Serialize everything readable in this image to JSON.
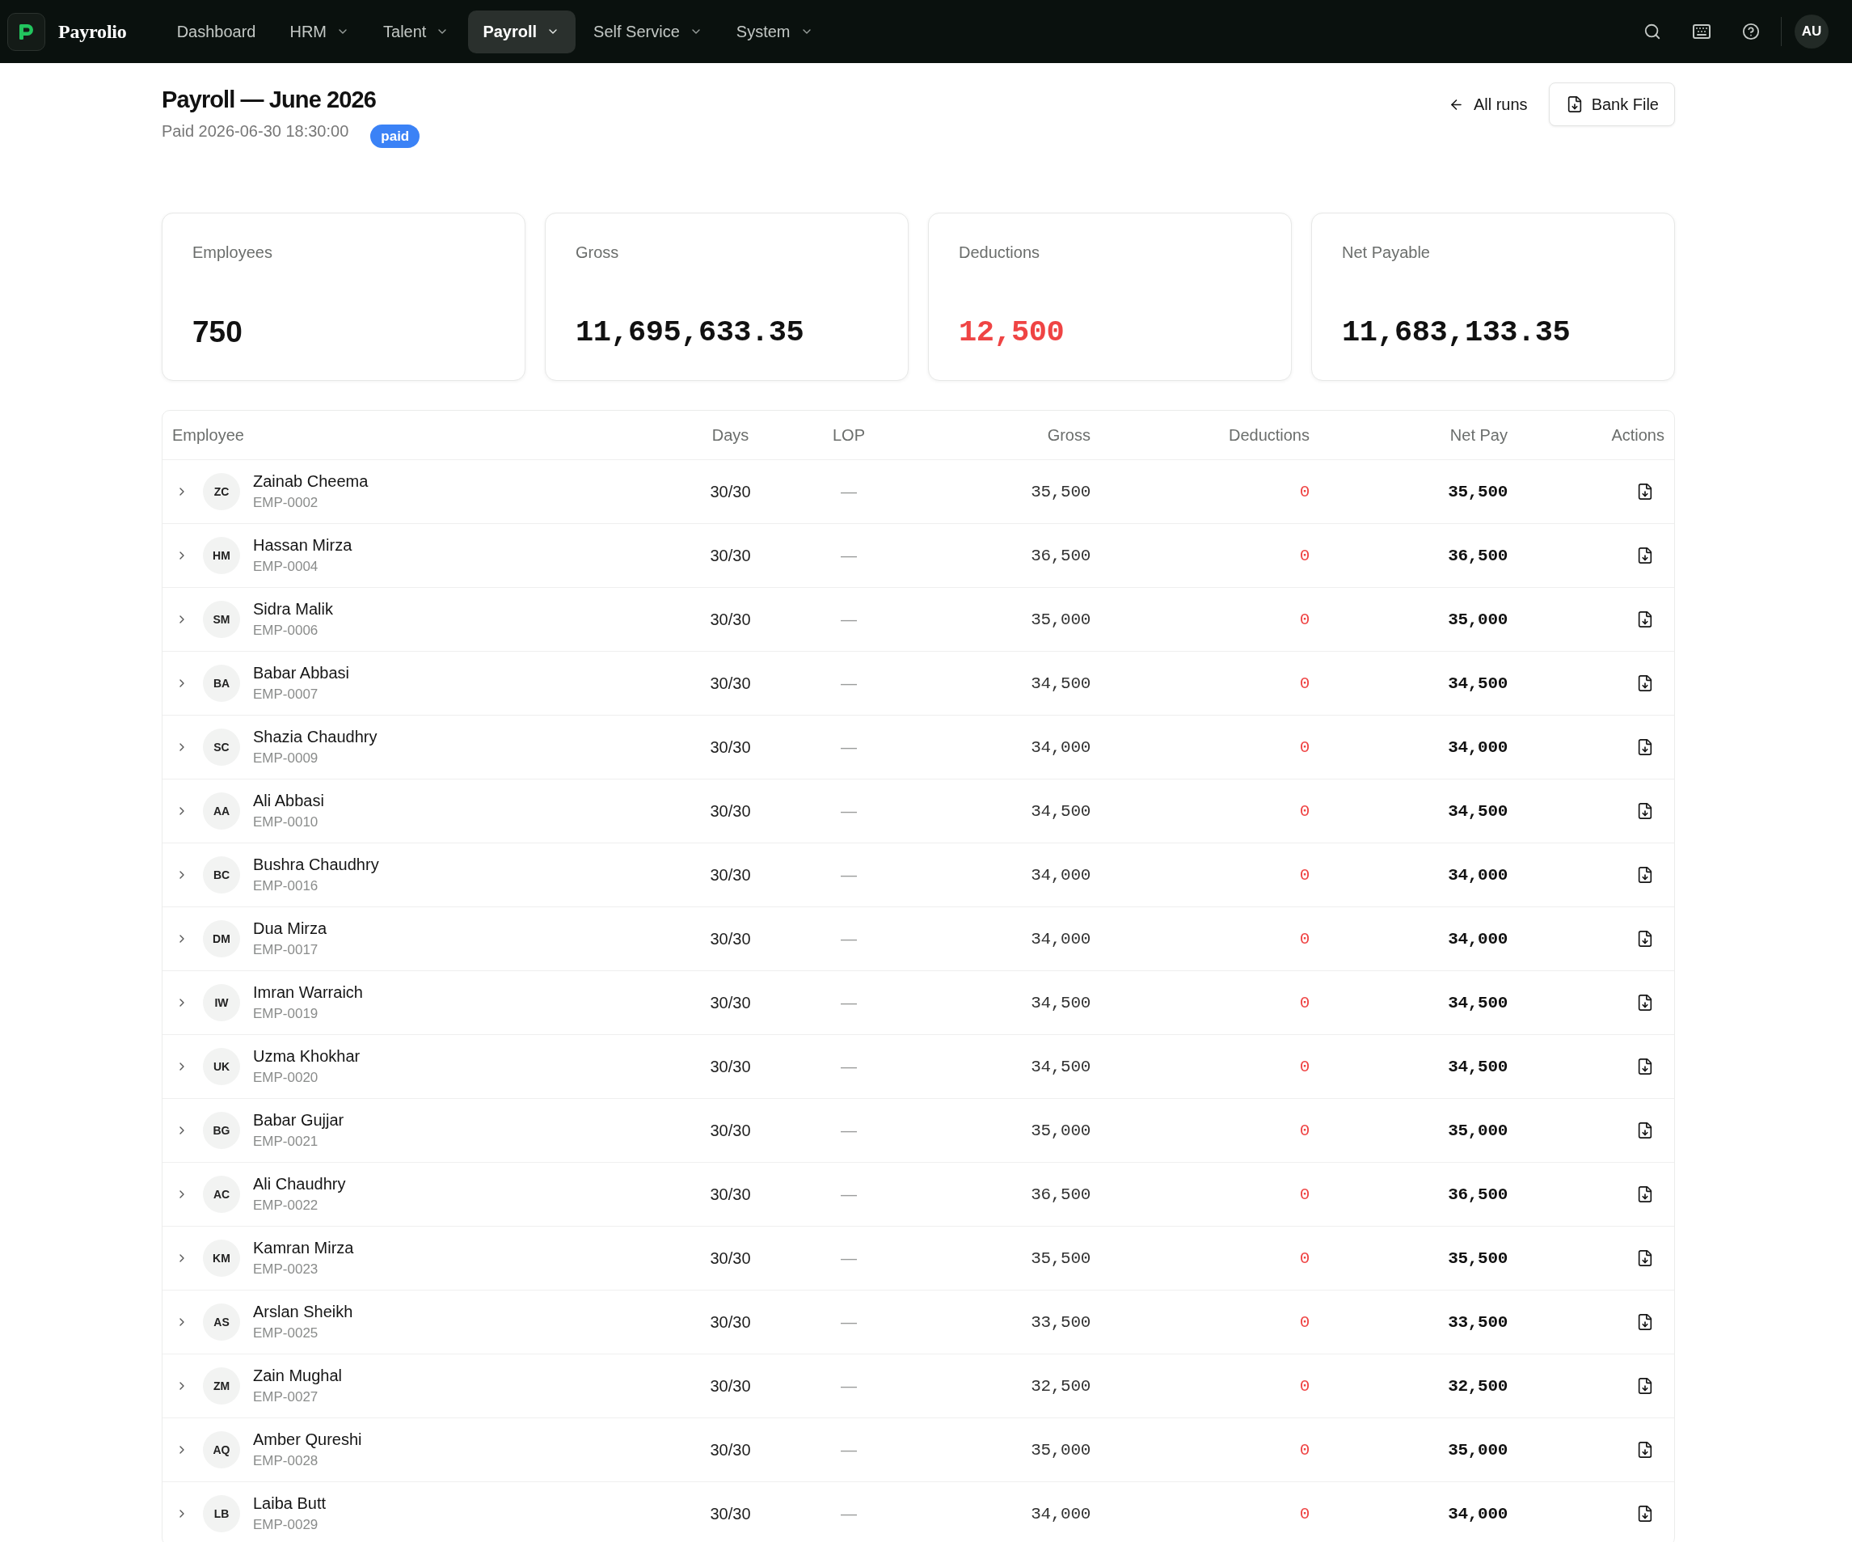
{
  "app": {
    "brand": "Payrolio"
  },
  "nav": {
    "items": [
      {
        "label": "Dashboard",
        "has_menu": false,
        "selected": false
      },
      {
        "label": "HRM",
        "has_menu": true,
        "selected": false
      },
      {
        "label": "Talent",
        "has_menu": true,
        "selected": false
      },
      {
        "label": "Payroll",
        "has_menu": true,
        "selected": true
      },
      {
        "label": "Self Service",
        "has_menu": true,
        "selected": false
      },
      {
        "label": "System",
        "has_menu": true,
        "selected": false
      }
    ]
  },
  "user": {
    "initials": "AU"
  },
  "header": {
    "title": "Payroll — June 2026",
    "subtitle": "Paid 2026-06-30 18:30:00",
    "badge": "paid",
    "back_link": "All runs",
    "button": "Bank File"
  },
  "stats": [
    {
      "label": "Employees",
      "value": "750",
      "kind": "count"
    },
    {
      "label": "Gross",
      "value": "11,695,633.35",
      "kind": "amount"
    },
    {
      "label": "Deductions",
      "value": "12,500",
      "kind": "deduction"
    },
    {
      "label": "Net Payable",
      "value": "11,683,133.35",
      "kind": "amount"
    }
  ],
  "table": {
    "columns": [
      "Employee",
      "Days",
      "LOP",
      "Gross",
      "Deductions",
      "Net Pay",
      "Actions"
    ],
    "rows": [
      {
        "initials": "ZC",
        "name": "Zainab Cheema",
        "id": "EMP-0002",
        "days": "30/30",
        "lop": "—",
        "gross": "35,500",
        "deductions": "0",
        "net_pay": "35,500",
        "expanded": false
      },
      {
        "initials": "HM",
        "name": "Hassan Mirza",
        "id": "EMP-0004",
        "days": "30/30",
        "lop": "—",
        "gross": "36,500",
        "deductions": "0",
        "net_pay": "36,500",
        "expanded": false
      },
      {
        "initials": "SM",
        "name": "Sidra Malik",
        "id": "EMP-0006",
        "days": "30/30",
        "lop": "—",
        "gross": "35,000",
        "deductions": "0",
        "net_pay": "35,000",
        "expanded": false
      },
      {
        "initials": "BA",
        "name": "Babar Abbasi",
        "id": "EMP-0007",
        "days": "30/30",
        "lop": "—",
        "gross": "34,500",
        "deductions": "0",
        "net_pay": "34,500",
        "expanded": false
      },
      {
        "initials": "SC",
        "name": "Shazia Chaudhry",
        "id": "EMP-0009",
        "days": "30/30",
        "lop": "—",
        "gross": "34,000",
        "deductions": "0",
        "net_pay": "34,000",
        "expanded": false
      },
      {
        "initials": "AA",
        "name": "Ali Abbasi",
        "id": "EMP-0010",
        "days": "30/30",
        "lop": "—",
        "gross": "34,500",
        "deductions": "0",
        "net_pay": "34,500",
        "expanded": false
      },
      {
        "initials": "BC",
        "name": "Bushra Chaudhry",
        "id": "EMP-0016",
        "days": "30/30",
        "lop": "—",
        "gross": "34,000",
        "deductions": "0",
        "net_pay": "34,000",
        "expanded": false
      },
      {
        "initials": "DM",
        "name": "Dua Mirza",
        "id": "EMP-0017",
        "days": "30/30",
        "lop": "—",
        "gross": "34,000",
        "deductions": "0",
        "net_pay": "34,000",
        "expanded": false
      },
      {
        "initials": "IW",
        "name": "Imran Warraich",
        "id": "EMP-0019",
        "days": "30/30",
        "lop": "—",
        "gross": "34,500",
        "deductions": "0",
        "net_pay": "34,500",
        "expanded": false
      },
      {
        "initials": "UK",
        "name": "Uzma Khokhar",
        "id": "EMP-0020",
        "days": "30/30",
        "lop": "—",
        "gross": "34,500",
        "deductions": "0",
        "net_pay": "34,500",
        "expanded": false
      },
      {
        "initials": "BG",
        "name": "Babar Gujjar",
        "id": "EMP-0021",
        "days": "30/30",
        "lop": "—",
        "gross": "35,000",
        "deductions": "0",
        "net_pay": "35,000",
        "expanded": false
      },
      {
        "initials": "AC",
        "name": "Ali Chaudhry",
        "id": "EMP-0022",
        "days": "30/30",
        "lop": "—",
        "gross": "36,500",
        "deductions": "0",
        "net_pay": "36,500",
        "expanded": false
      },
      {
        "initials": "KM",
        "name": "Kamran Mirza",
        "id": "EMP-0023",
        "days": "30/30",
        "lop": "—",
        "gross": "35,500",
        "deductions": "0",
        "net_pay": "35,500",
        "expanded": false
      },
      {
        "initials": "AS",
        "name": "Arslan Sheikh",
        "id": "EMP-0025",
        "days": "30/30",
        "lop": "—",
        "gross": "33,500",
        "deductions": "0",
        "net_pay": "33,500",
        "expanded": false
      },
      {
        "initials": "ZM",
        "name": "Zain Mughal",
        "id": "EMP-0027",
        "days": "30/30",
        "lop": "—",
        "gross": "32,500",
        "deductions": "0",
        "net_pay": "32,500",
        "expanded": false
      },
      {
        "initials": "AQ",
        "name": "Amber Qureshi",
        "id": "EMP-0028",
        "days": "30/30",
        "lop": "—",
        "gross": "35,000",
        "deductions": "0",
        "net_pay": "35,000",
        "expanded": false
      },
      {
        "initials": "LB",
        "name": "Laiba Butt",
        "id": "EMP-0029",
        "days": "30/30",
        "lop": "—",
        "gross": "34,000",
        "deductions": "0",
        "net_pay": "34,000",
        "expanded": false
      }
    ]
  }
}
